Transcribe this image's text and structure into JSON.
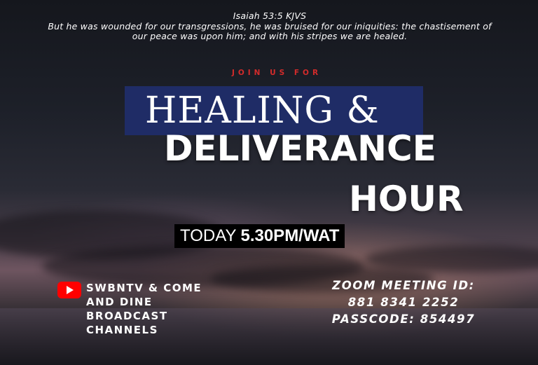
{
  "verse": {
    "reference": "Isaiah 53:5 KJVS",
    "text": "But he was wounded for our transgressions, he was bruised for our iniquities: the chastisement of our peace was upon him; and with his stripes we are healed."
  },
  "invite": "JOIN US FOR",
  "title": {
    "line1": "HEALING &",
    "line2": "DELIVERANCE",
    "line3": "HOUR"
  },
  "schedule": {
    "day": "TODAY",
    "time": "5.30PM/WAT"
  },
  "broadcast": {
    "icon": "youtube-icon",
    "line1": "SWBNTV & COME",
    "line2": "AND DINE",
    "line3": "BROADCAST",
    "line4": "CHANNELS"
  },
  "zoom": {
    "meeting_id_label": "ZOOM MEETING ID:",
    "meeting_id": "881 8341 2252",
    "passcode_line": "PASSCODE: 854497"
  },
  "colors": {
    "accent_red": "#d32b2b",
    "title_box_blue": "#1f2e6b",
    "youtube_red": "#ff0000"
  }
}
